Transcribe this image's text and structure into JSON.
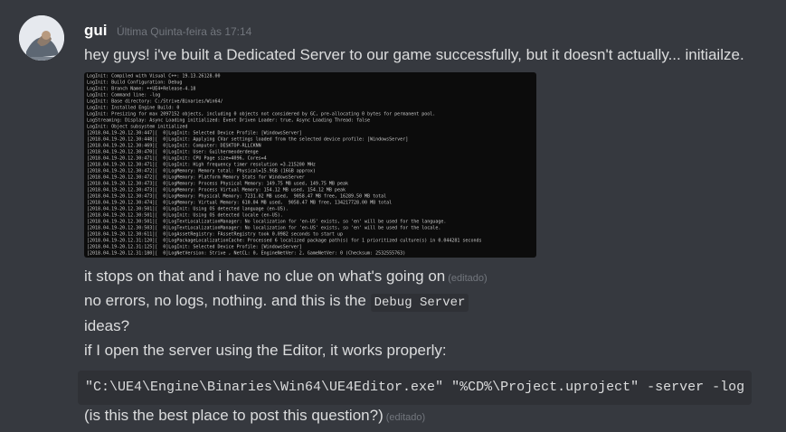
{
  "message": {
    "username": "gui",
    "timestamp": "Última Quinta-feira às 17:14",
    "line1": "hey guys! i've built a Dedicated Server to our game successfully, but it doesn't actually... initiailze.",
    "line2": "it stops on that and i have no clue on what's going on",
    "line3_prefix": "no errors, no logs, nothing. and this is the",
    "line3_code": "Debug Server",
    "line4": "ideas?",
    "line5": "if I open the server using the Editor, it works properly:",
    "code_block": "\"C:\\UE4\\Engine\\Binaries\\Win64\\UE4Editor.exe\" \"%CD%\\Project.uproject\" -server -log",
    "line6": "(is this the best place to post this question?)",
    "edited_label": "(editado)",
    "edited_label_2": "(editado)"
  },
  "console": {
    "lines": [
      "LogInit: Compiled with Visual C++: 19.13.26128.00",
      "LogInit: Build Configuration: Debug",
      "LogInit: Branch Name: ++UE4+Release-4.18",
      "LogInit: Command line: -log",
      "LogInit: Base directory: C:/Strive/Binaries/Win64/",
      "LogInit: Installed Engine Build: 0",
      "LogInit: Presizing for max 2097152 objects, including 0 objects not considered by GC, pre-allocating 0 bytes for permanent pool.",
      "LogStreaming: Display: Async Loading initialized: Event Driven Loader: true, Async Loading Thread: false",
      "LogInit: Object subsystem initialized",
      "[2018.04.19-20.12.30:447][  0]LogInit: Selected Device Profile: [WindowsServer]",
      "[2018.04.19-20.12.30:448][  0]LogInit: Applying CVar settings loaded from the selected device profile: [WindowsServer]",
      "[2018.04.19-20.12.30:469][  0]LogInit: Computer: DESKTOP-RLLCKNN",
      "[2018.04.19-20.12.30:470][  0]LogInit: User: Guilhermeoderdenge",
      "[2018.04.19-20.12.30:471][  0]LogInit: CPU Page size=4096, Cores=4",
      "[2018.04.19-20.12.30:471][  0]LogInit: High frequency timer resolution =3.215200 MHz",
      "[2018.04.19-20.12.30:472][  0]LogMemory: Memory total: Physical=15.9GB (16GB approx)",
      "[2018.04.19-20.12.30:472][  0]LogMemory: Platform Memory Stats for WindowsServer",
      "[2018.04.19-20.12.30:473][  0]LogMemory: Process Physical Memory: 149.75 MB used, 149.75 MB peak",
      "[2018.04.19-20.12.30:473][  0]LogMemory: Process Virtual Memory: 154.12 MB used, 154.12 MB peak",
      "[2018.04.19-20.12.30:473][  0]LogMemory: Physical Memory: 7231.02 MB used,  9058.47 MB free, 16289.50 MB total",
      "[2018.04.19-20.12.30:474][  0]LogMemory: Virtual Memory: 610.04 MB used,  9058.47 MB free, 134217728.00 MB total",
      "[2018.04.19-20.12.30:501][  0]LogInit: Using OS detected language (en-US).",
      "[2018.04.19-20.12.30:501][  0]LogInit: Using OS detected locale (en-US).",
      "[2018.04.19-20.12.30:501][  0]LogTextLocalizationManager: No localization for 'en-US' exists, so 'en' will be used for the language.",
      "[2018.04.19-20.12.30:503][  0]LogTextLocalizationManager: No localization for 'en-US' exists, so 'en' will be used for the locale.",
      "[2018.04.19-20.12.30:611][  0]LogAssetRegistry: FAssetRegistry took 0.0982 seconds to start up",
      "[2018.04.19-20.12.31:120][  0]LogPackageLocalizationCache: Processed 6 localized package path(s) for 1 prioritized culture(s) in 0.044281 seconds",
      "[2018.04.19-20.12.31:125][  0]LogInit: Selected Device Profile: [WindowsServer]",
      "[2018.04.19-20.12.31:180][  0]LogNetVersion: Strive , NetCL: 0, EngineNetVer: 2, GameNetVer: 0 (Checksum: 2532555763)"
    ]
  }
}
